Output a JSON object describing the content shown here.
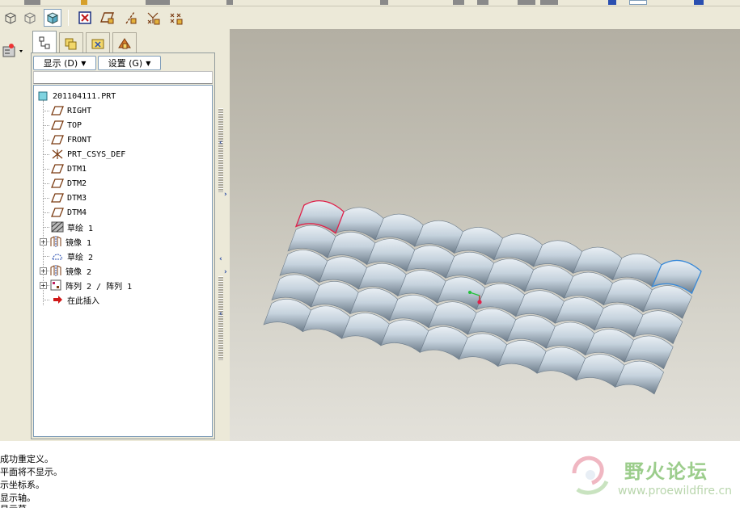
{
  "toolbar": {
    "buttons": [
      "shading-cube-icon",
      "hidden-line-cube-icon",
      "shaded-cube-icon",
      "datum-display-x-icon",
      "datum-plane-display-icon",
      "datum-axis-display-icon",
      "datum-point-display-icon",
      "csys-display-icon"
    ]
  },
  "navigator": {
    "tabs": [
      "model-tree-tab",
      "layer-tree-tab",
      "folder-browser-tab",
      "favorites-tab"
    ],
    "show_menu": "显示 (D)",
    "settings_menu": "设置 (G)",
    "tree": [
      {
        "label": "201104111.PRT",
        "icon": "part-icon",
        "level": 0,
        "expandable": false
      },
      {
        "label": "RIGHT",
        "icon": "datum-plane-icon",
        "level": 1,
        "expandable": false
      },
      {
        "label": "TOP",
        "icon": "datum-plane-icon",
        "level": 1,
        "expandable": false
      },
      {
        "label": "FRONT",
        "icon": "datum-plane-icon",
        "level": 1,
        "expandable": false
      },
      {
        "label": "PRT_CSYS_DEF",
        "icon": "csys-icon",
        "level": 1,
        "expandable": false
      },
      {
        "label": "DTM1",
        "icon": "datum-plane-icon",
        "level": 1,
        "expandable": false
      },
      {
        "label": "DTM2",
        "icon": "datum-plane-icon",
        "level": 1,
        "expandable": false
      },
      {
        "label": "DTM3",
        "icon": "datum-plane-icon",
        "level": 1,
        "expandable": false
      },
      {
        "label": "DTM4",
        "icon": "datum-plane-icon",
        "level": 1,
        "expandable": false
      },
      {
        "label": "草绘 1",
        "icon": "sketch-hatched-icon",
        "level": 1,
        "expandable": false
      },
      {
        "label": "镜像 1",
        "icon": "mirror-icon",
        "level": 1,
        "expandable": true
      },
      {
        "label": "草绘 2",
        "icon": "sketch-icon",
        "level": 1,
        "expandable": false
      },
      {
        "label": "镜像 2",
        "icon": "mirror-icon",
        "level": 1,
        "expandable": true
      },
      {
        "label": "阵列 2 / 阵列 1",
        "icon": "pattern-icon",
        "level": 1,
        "expandable": true
      },
      {
        "label": "在此插入",
        "icon": "insert-here-arrow-icon",
        "level": 1,
        "expandable": false
      }
    ]
  },
  "messages": [
    "成功重定义。",
    "平面将不显示。",
    "示坐标系。",
    "显示轴。",
    "显示草"
  ],
  "watermark": {
    "title": "野火论坛",
    "url": "www.proewildfire.cn"
  },
  "colors": {
    "highlight_red": "#e0204a",
    "highlight_blue": "#3a8ad8",
    "surface": "#c8d4df"
  }
}
